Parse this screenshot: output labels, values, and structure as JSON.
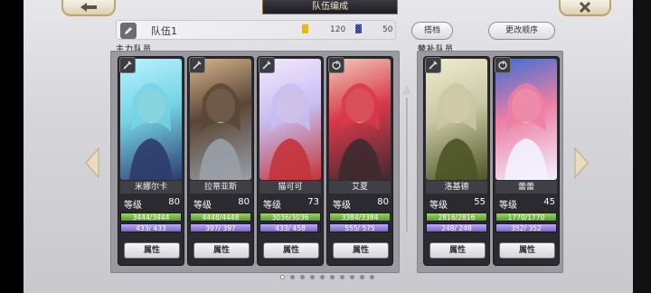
{
  "header": {
    "title": "队伍编成",
    "back_icon": "arrow-left-icon",
    "close_icon": "close-icon"
  },
  "team": {
    "name": "队伍1",
    "stat_a": {
      "icon": "yellow-stat-icon",
      "value": "120",
      "color": "#d9b000"
    },
    "stat_b": {
      "icon": "blue-stat-icon",
      "value": "50",
      "color": "#1e2a9b"
    },
    "btn_partner": "搭档",
    "btn_reorder": "更改顺序"
  },
  "sections": {
    "main": "主力队员",
    "reserve": "替补队员"
  },
  "labels": {
    "level": "等级",
    "attr_button": "属性"
  },
  "main_members": [
    {
      "name": "米娜尔卡",
      "level": "80",
      "hp": "3444/3444",
      "mp": "433/ 433",
      "hp_pct": 100,
      "mp_pct": 100,
      "class_icon": "sword-class-icon",
      "palette": [
        "#74d3e4",
        "#2e3b6c",
        "#b8f3ff"
      ]
    },
    {
      "name": "拉蒂亚斯",
      "level": "80",
      "hp": "4448/4448",
      "mp": "397/ 397",
      "hp_pct": 100,
      "mp_pct": 100,
      "class_icon": "sword-class-icon",
      "palette": [
        "#5a4636",
        "#9aa0a8",
        "#d7b48c"
      ]
    },
    {
      "name": "猫可可",
      "level": "73",
      "hp": "3036/3036",
      "mp": "433/ 458",
      "hp_pct": 100,
      "mp_pct": 95,
      "class_icon": "sword-class-icon",
      "palette": [
        "#c8bdf0",
        "#c4343a",
        "#f4e9ff"
      ]
    },
    {
      "name": "艾夏",
      "level": "80",
      "hp": "3384/3384",
      "mp": "555/ 575",
      "hp_pct": 100,
      "mp_pct": 97,
      "class_icon": "spiral-class-icon",
      "palette": [
        "#d7394a",
        "#3d2a30",
        "#f3c9b7"
      ]
    }
  ],
  "reserve_members": [
    {
      "name": "洛基德",
      "level": "55",
      "hp": "2816/2816",
      "mp": "248/ 248",
      "hp_pct": 100,
      "mp_pct": 100,
      "class_icon": "sword-class-icon",
      "palette": [
        "#c9c8a4",
        "#4d5425",
        "#f0ecd0"
      ]
    },
    {
      "name": "蕾蕾",
      "level": "45",
      "hp": "1770/1770",
      "mp": "352/ 352",
      "hp_pct": 100,
      "mp_pct": 100,
      "class_icon": "spiral-class-icon",
      "palette": [
        "#ec7fa4",
        "#f3f1ff",
        "#3a6fd6"
      ]
    }
  ],
  "pager": {
    "total": 10,
    "active": 1
  }
}
